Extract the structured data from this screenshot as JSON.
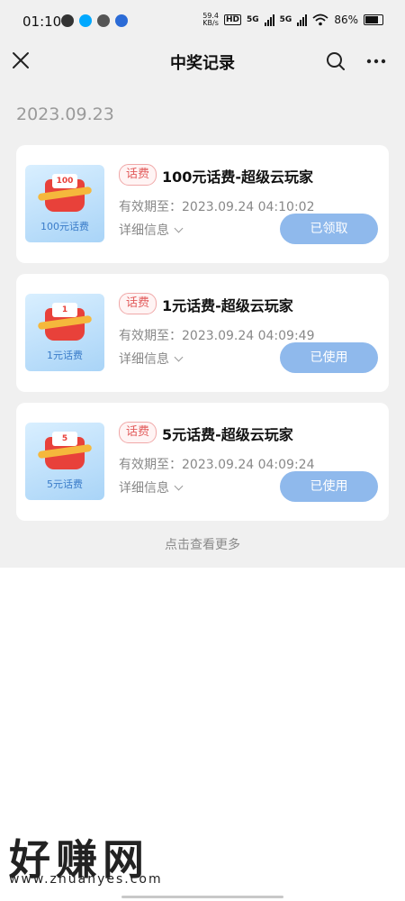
{
  "status_bar": {
    "time": "01:10",
    "net_speed_value": "59.4",
    "net_speed_unit": "KB/s",
    "hd_label": "HD",
    "sig1_label": "5G",
    "sig2_label": "5G",
    "battery": "86%"
  },
  "header": {
    "title": "中奖记录"
  },
  "date": "2023.09.23",
  "cards": [
    {
      "thumb_badge": "100",
      "thumb_label": "100元话费",
      "tag": "话费",
      "title": "100元话费-超级云玩家",
      "valid": "有效期至：2023.09.24 04:10:02",
      "detail": "详细信息",
      "button": "已领取"
    },
    {
      "thumb_badge": "1",
      "thumb_label": "1元话费",
      "tag": "话费",
      "title": "1元话费-超级云玩家",
      "valid": "有效期至：2023.09.24 04:09:49",
      "detail": "详细信息",
      "button": "已使用"
    },
    {
      "thumb_badge": "5",
      "thumb_label": "5元话费",
      "tag": "话费",
      "title": "5元话费-超级云玩家",
      "valid": "有效期至：2023.09.24 04:09:24",
      "detail": "详细信息",
      "button": "已使用"
    }
  ],
  "load_more": "点击查看更多",
  "watermark": {
    "text": "好赚网",
    "url": "www.zhuanyes.com"
  },
  "colors": {
    "page_bg": "#f0f0f0",
    "button_bg": "#8fb9ec",
    "tag_red": "#e25c5c",
    "gift_red": "#e8413a"
  }
}
